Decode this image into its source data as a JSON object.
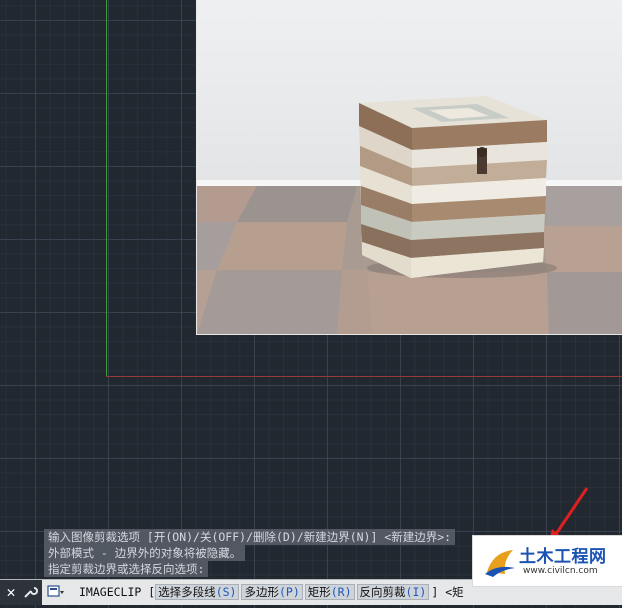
{
  "history": {
    "line1": "输入图像剪裁选项 [开(ON)/关(OFF)/删除(D)/新建边界(N)] <新建边界>:",
    "line2": "外部模式 - 边界外的对象将被隐藏。",
    "line3": "指定剪裁边界或选择反向选项:"
  },
  "command_bar": {
    "command": "IMAGECLIP",
    "open_bracket": "[",
    "options": [
      {
        "label": "选择多段线",
        "key": "(S)"
      },
      {
        "label": "多边形",
        "key": "(P)"
      },
      {
        "label": "矩形",
        "key": "(R)"
      },
      {
        "label": "反向剪裁",
        "key": "(I)"
      }
    ],
    "close_bracket": "]",
    "trailing": "<矩"
  },
  "watermark": {
    "title": "土木工程网",
    "url": "www.civilcn.com"
  },
  "colors": {
    "canvas_bg": "#212830",
    "y_axis": "#3f9a3f",
    "x_axis": "#9a3838",
    "logo_blue": "#1b53b3",
    "arrow_red": "#e02020"
  }
}
